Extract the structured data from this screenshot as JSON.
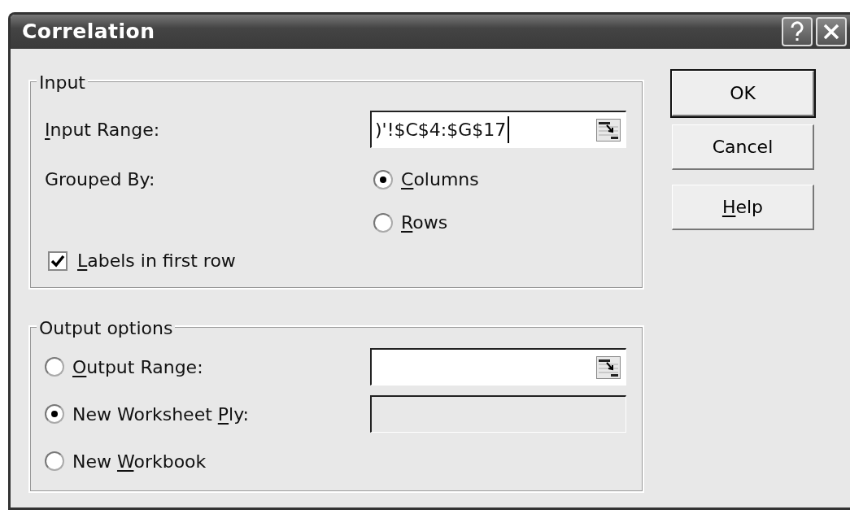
{
  "window": {
    "title": "Correlation"
  },
  "input": {
    "title": "Input",
    "range": {
      "label": {
        "key": "I",
        "after": "nput Range:"
      },
      "value": ")'!$C$4:$G$17"
    },
    "grouped_by": {
      "label": "Grouped By:",
      "options": [
        {
          "label": {
            "key": "C",
            "after": "olumns"
          },
          "selected": true
        },
        {
          "label": {
            "key": "R",
            "after": "ows"
          },
          "selected": false
        }
      ]
    },
    "labels_in_first_row": {
      "label": {
        "key": "L",
        "after": "abels in first row"
      },
      "checked": true
    }
  },
  "output": {
    "title": "Output options",
    "options": [
      {
        "label": {
          "key": "O",
          "after": "utput Range:"
        },
        "selected": false,
        "field": {
          "kind": "range",
          "disabled": false
        }
      },
      {
        "label": {
          "before": "New Worksheet ",
          "key": "P",
          "after": "ly:"
        },
        "selected": true,
        "field": {
          "kind": "plain",
          "disabled": true
        }
      },
      {
        "label": {
          "before": "New ",
          "key": "W",
          "after": "orkbook"
        },
        "selected": false
      }
    ]
  },
  "buttons": [
    {
      "label": {
        "after": "OK"
      },
      "default": true
    },
    {
      "label": {
        "after": "Cancel"
      },
      "default": false
    },
    {
      "label": {
        "key": "H",
        "after": "elp"
      },
      "default": false
    }
  ]
}
